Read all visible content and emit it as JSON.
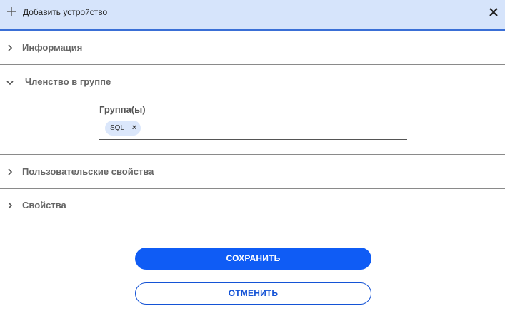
{
  "header": {
    "title": "Добавить устройство",
    "add_icon": "plus-icon",
    "close_icon": "close-icon"
  },
  "sections": {
    "info": {
      "label": "Информация",
      "expanded": false
    },
    "membership": {
      "label": "Членство в группе",
      "expanded": true
    },
    "custom_props": {
      "label": "Пользовательские свойства",
      "expanded": false
    },
    "props": {
      "label": "Свойства",
      "expanded": false
    }
  },
  "membership": {
    "groups_label": "Группа(ы)",
    "chips": [
      {
        "label": "SQL",
        "remove": "×"
      }
    ]
  },
  "buttons": {
    "save": "СОХРАНИТЬ",
    "cancel": "ОТМЕНИТЬ"
  },
  "colors": {
    "header_bg": "#d6e4fb",
    "header_accent": "#3a6fd6",
    "primary": "#0f5cf5",
    "chip_bg": "#dbe7fb"
  }
}
